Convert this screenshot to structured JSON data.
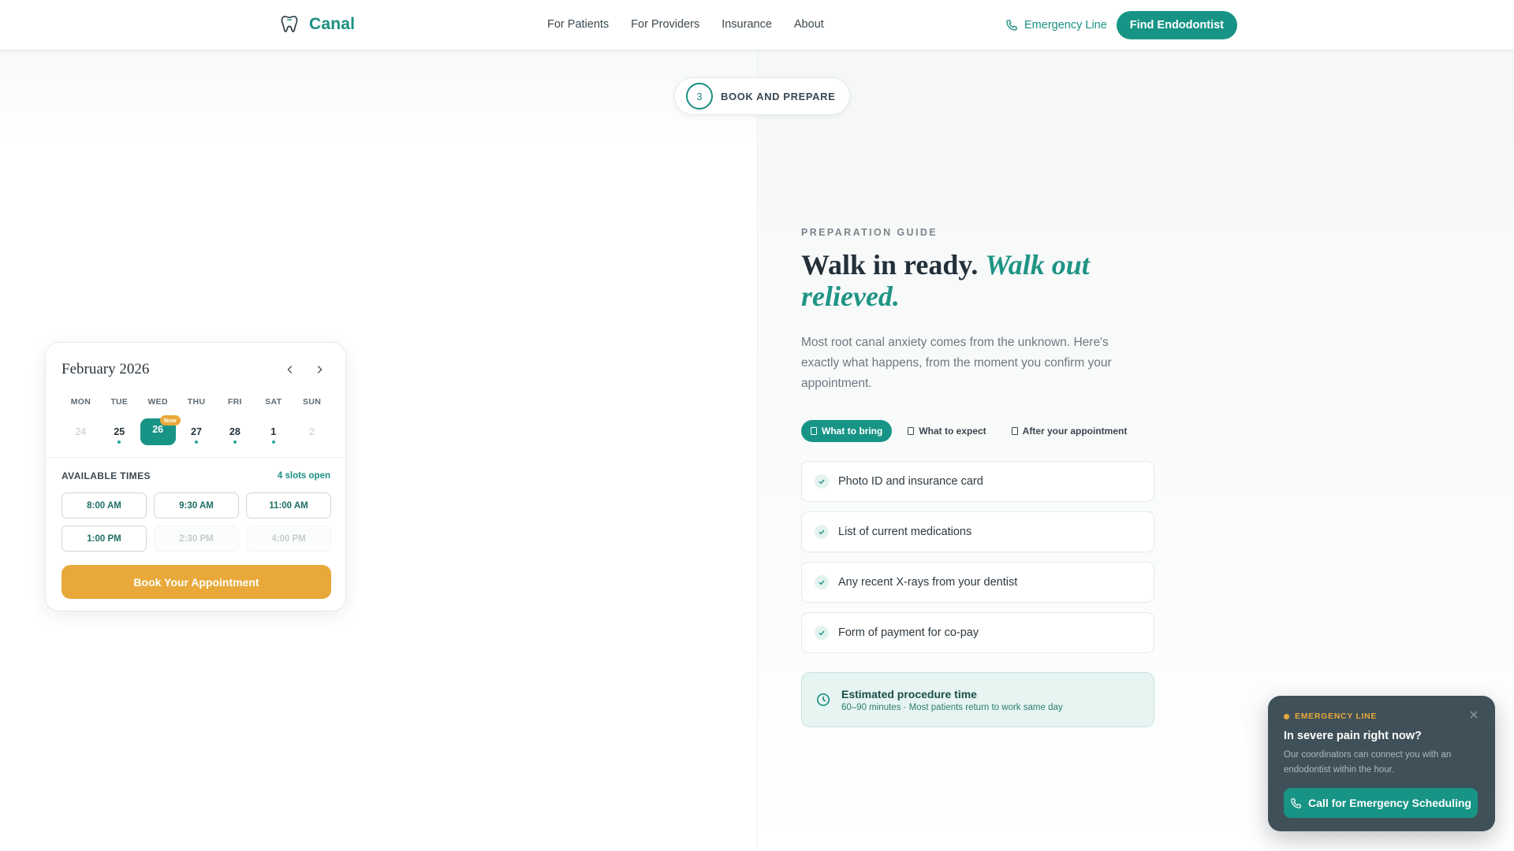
{
  "brand": {
    "name": "Canal",
    "icon": "tooth-icon",
    "color": "#1a8f82"
  },
  "nav": {
    "links": [
      "For Patients",
      "For Providers",
      "Insurance",
      "About"
    ],
    "emergency_label": "Emergency Line",
    "cta_label": "Find Endodontist"
  },
  "step": {
    "number": "3",
    "label": "BOOK AND PREPARE"
  },
  "calendar": {
    "month": "February 2026",
    "weekdays": [
      "MON",
      "TUE",
      "WED",
      "THU",
      "FRI",
      "SAT",
      "SUN"
    ],
    "dates": [
      {
        "day": "24",
        "muted": true,
        "available": false
      },
      {
        "day": "25",
        "muted": false,
        "available": true
      },
      {
        "day": "26",
        "muted": false,
        "selected": true,
        "badge": "Now"
      },
      {
        "day": "27",
        "muted": false,
        "available": true
      },
      {
        "day": "28",
        "muted": false,
        "available": true
      },
      {
        "day": "1",
        "muted": false,
        "available": true
      },
      {
        "day": "2",
        "muted": true,
        "available": false
      }
    ],
    "available_label": "AVAILABLE TIMES",
    "slots_open": "4 slots open",
    "times": [
      {
        "label": "8:00 AM",
        "available": true
      },
      {
        "label": "9:30 AM",
        "available": true
      },
      {
        "label": "11:00 AM",
        "available": true
      },
      {
        "label": "1:00 PM",
        "available": true
      },
      {
        "label": "2:30 PM",
        "available": false
      },
      {
        "label": "4:00 PM",
        "available": false
      }
    ],
    "book_label": "Book Your Appointment"
  },
  "guide": {
    "eyebrow": "PREPARATION GUIDE",
    "headline_plain": "Walk in ready. ",
    "headline_accent": "Walk out relieved.",
    "intro": "Most root canal anxiety comes from the unknown. Here's exactly what happens, from the moment you confirm your appointment.",
    "tabs": [
      {
        "label": "What to bring",
        "active": true
      },
      {
        "label": "What to expect",
        "active": false
      },
      {
        "label": "After your appointment",
        "active": false
      }
    ],
    "checklist": [
      "Photo ID and insurance card",
      "List of current medications",
      "Any recent X-rays from your dentist",
      "Form of payment for co-pay"
    ],
    "estimate": {
      "title": "Estimated procedure time",
      "subtitle": "60–90 minutes · Most patients return to work same day"
    }
  },
  "emergency_widget": {
    "tag": "EMERGENCY LINE",
    "title": "In severe pain right now?",
    "description": "Our coordinators can connect you with an endodontist within the hour.",
    "button_label": "Call for Emergency Scheduling"
  },
  "colors": {
    "teal": "#179485",
    "amber": "#e8a93a",
    "widget_bg": "#3f5058"
  }
}
